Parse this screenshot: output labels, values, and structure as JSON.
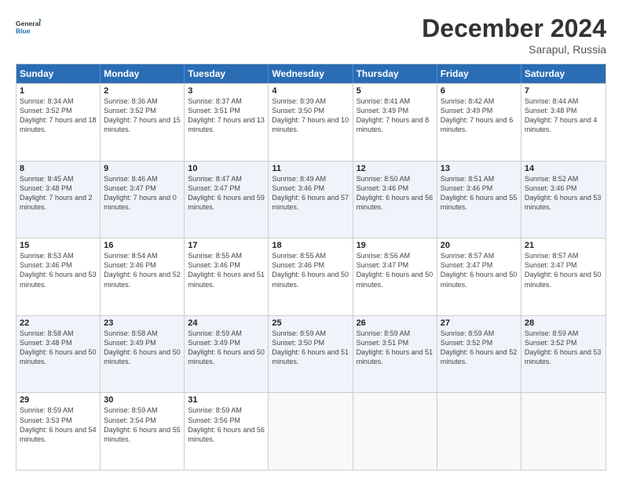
{
  "logo": {
    "line1": "General",
    "line2": "Blue"
  },
  "title": "December 2024",
  "subtitle": "Sarapul, Russia",
  "days": [
    "Sunday",
    "Monday",
    "Tuesday",
    "Wednesday",
    "Thursday",
    "Friday",
    "Saturday"
  ],
  "weeks": [
    [
      {
        "day": "1",
        "sunrise": "8:34 AM",
        "sunset": "3:52 PM",
        "daylight": "7 hours and 18 minutes."
      },
      {
        "day": "2",
        "sunrise": "8:36 AM",
        "sunset": "3:52 PM",
        "daylight": "7 hours and 15 minutes."
      },
      {
        "day": "3",
        "sunrise": "8:37 AM",
        "sunset": "3:51 PM",
        "daylight": "7 hours and 13 minutes."
      },
      {
        "day": "4",
        "sunrise": "8:39 AM",
        "sunset": "3:50 PM",
        "daylight": "7 hours and 10 minutes."
      },
      {
        "day": "5",
        "sunrise": "8:41 AM",
        "sunset": "3:49 PM",
        "daylight": "7 hours and 8 minutes."
      },
      {
        "day": "6",
        "sunrise": "8:42 AM",
        "sunset": "3:49 PM",
        "daylight": "7 hours and 6 minutes."
      },
      {
        "day": "7",
        "sunrise": "8:44 AM",
        "sunset": "3:48 PM",
        "daylight": "7 hours and 4 minutes."
      }
    ],
    [
      {
        "day": "8",
        "sunrise": "8:45 AM",
        "sunset": "3:48 PM",
        "daylight": "7 hours and 2 minutes."
      },
      {
        "day": "9",
        "sunrise": "8:46 AM",
        "sunset": "3:47 PM",
        "daylight": "7 hours and 0 minutes."
      },
      {
        "day": "10",
        "sunrise": "8:47 AM",
        "sunset": "3:47 PM",
        "daylight": "6 hours and 59 minutes."
      },
      {
        "day": "11",
        "sunrise": "8:49 AM",
        "sunset": "3:46 PM",
        "daylight": "6 hours and 57 minutes."
      },
      {
        "day": "12",
        "sunrise": "8:50 AM",
        "sunset": "3:46 PM",
        "daylight": "6 hours and 56 minutes."
      },
      {
        "day": "13",
        "sunrise": "8:51 AM",
        "sunset": "3:46 PM",
        "daylight": "6 hours and 55 minutes."
      },
      {
        "day": "14",
        "sunrise": "8:52 AM",
        "sunset": "3:46 PM",
        "daylight": "6 hours and 53 minutes."
      }
    ],
    [
      {
        "day": "15",
        "sunrise": "8:53 AM",
        "sunset": "3:46 PM",
        "daylight": "6 hours and 53 minutes."
      },
      {
        "day": "16",
        "sunrise": "8:54 AM",
        "sunset": "3:46 PM",
        "daylight": "6 hours and 52 minutes."
      },
      {
        "day": "17",
        "sunrise": "8:55 AM",
        "sunset": "3:46 PM",
        "daylight": "6 hours and 51 minutes."
      },
      {
        "day": "18",
        "sunrise": "8:55 AM",
        "sunset": "3:46 PM",
        "daylight": "6 hours and 50 minutes."
      },
      {
        "day": "19",
        "sunrise": "8:56 AM",
        "sunset": "3:47 PM",
        "daylight": "6 hours and 50 minutes."
      },
      {
        "day": "20",
        "sunrise": "8:57 AM",
        "sunset": "3:47 PM",
        "daylight": "6 hours and 50 minutes."
      },
      {
        "day": "21",
        "sunrise": "8:57 AM",
        "sunset": "3:47 PM",
        "daylight": "6 hours and 50 minutes."
      }
    ],
    [
      {
        "day": "22",
        "sunrise": "8:58 AM",
        "sunset": "3:48 PM",
        "daylight": "6 hours and 50 minutes."
      },
      {
        "day": "23",
        "sunrise": "8:58 AM",
        "sunset": "3:49 PM",
        "daylight": "6 hours and 50 minutes."
      },
      {
        "day": "24",
        "sunrise": "8:59 AM",
        "sunset": "3:49 PM",
        "daylight": "6 hours and 50 minutes."
      },
      {
        "day": "25",
        "sunrise": "8:59 AM",
        "sunset": "3:50 PM",
        "daylight": "6 hours and 51 minutes."
      },
      {
        "day": "26",
        "sunrise": "8:59 AM",
        "sunset": "3:51 PM",
        "daylight": "6 hours and 51 minutes."
      },
      {
        "day": "27",
        "sunrise": "8:59 AM",
        "sunset": "3:52 PM",
        "daylight": "6 hours and 52 minutes."
      },
      {
        "day": "28",
        "sunrise": "8:59 AM",
        "sunset": "3:52 PM",
        "daylight": "6 hours and 53 minutes."
      }
    ],
    [
      {
        "day": "29",
        "sunrise": "8:59 AM",
        "sunset": "3:53 PM",
        "daylight": "6 hours and 54 minutes."
      },
      {
        "day": "30",
        "sunrise": "8:59 AM",
        "sunset": "3:54 PM",
        "daylight": "6 hours and 55 minutes."
      },
      {
        "day": "31",
        "sunrise": "8:59 AM",
        "sunset": "3:56 PM",
        "daylight": "6 hours and 56 minutes."
      },
      null,
      null,
      null,
      null
    ]
  ]
}
